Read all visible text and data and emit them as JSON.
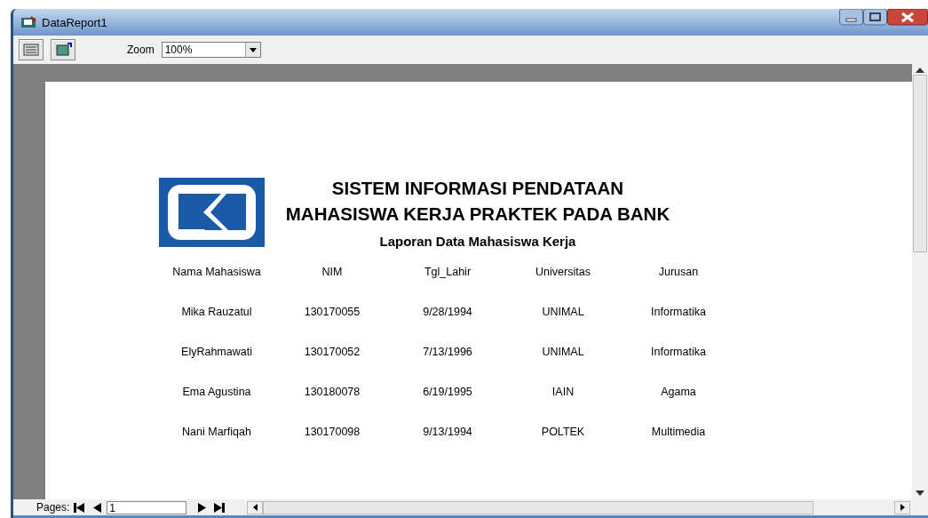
{
  "window": {
    "title": "DataReport1"
  },
  "toolbar": {
    "zoom_label": "Zoom",
    "zoom": {
      "value": "100%"
    }
  },
  "report": {
    "title_lines": [
      "SISTEM INFORMASI PENDATAAN",
      "MAHASISWA KERJA PRAKTEK PADA BANK"
    ],
    "subtitle": "Laporan Data Mahasiswa Kerja",
    "table": {
      "columns": [
        "Nama Mahasiswa",
        "NIM",
        "Tgl_Lahir",
        "Universitas",
        "Jurusan"
      ],
      "rows": [
        [
          "Mika Rauzatul",
          "130170055",
          "9/28/1994",
          "UNIMAL",
          "Informatika"
        ],
        [
          "ElyRahmawati",
          "130170052",
          "7/13/1996",
          "UNIMAL",
          "Informatika"
        ],
        [
          "Ema Agustina",
          "130180078",
          "6/19/1995",
          "IAIN",
          "Agama"
        ],
        [
          "Nani Marfiqah",
          "130170098",
          "9/13/1994",
          "POLTEK",
          "Multimedia"
        ]
      ]
    }
  },
  "status_bar": {
    "pages_label": "Pages:",
    "page_field": {
      "value": "1"
    }
  }
}
